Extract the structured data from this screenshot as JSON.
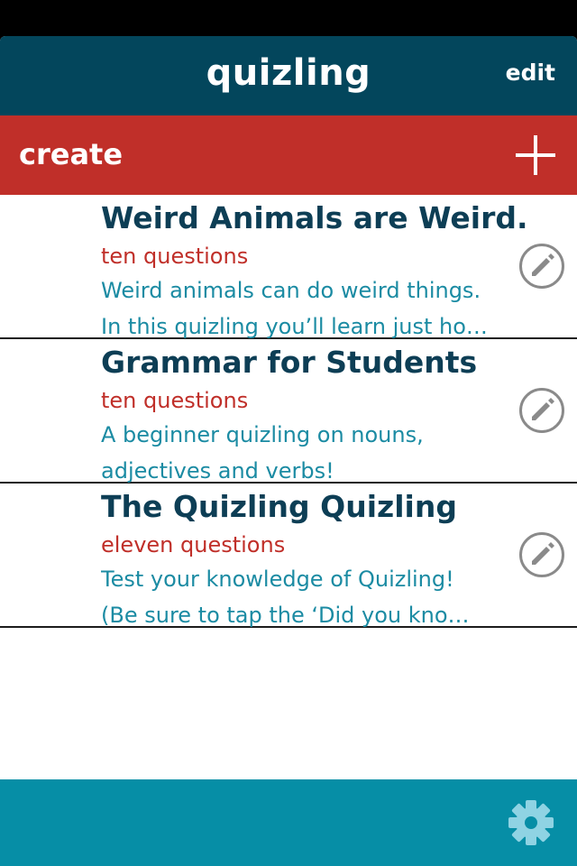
{
  "header": {
    "title": "quizling",
    "edit_label": "edit"
  },
  "create_bar": {
    "label": "create",
    "icon": "plus-icon"
  },
  "quizzes": [
    {
      "title": "Weird Animals are Weird.",
      "count": "ten questions",
      "desc_line1": "Weird animals can do weird things.",
      "desc_line2": "In this quizling you’ll learn just ho…"
    },
    {
      "title": "Grammar for Students",
      "count": "ten questions",
      "desc_line1": "A beginner quizling on nouns,",
      "desc_line2": "adjectives and verbs!"
    },
    {
      "title": "The Quizling Quizling",
      "count": "eleven questions",
      "desc_line1": "Test your knowledge of Quizling!",
      "desc_line2": "(Be sure to tap the ‘Did you kno…"
    }
  ],
  "footer": {
    "icon": "gear-icon"
  },
  "colors": {
    "navbar": "#03465c",
    "create_bar": "#c02f29",
    "title_text": "#0d3e55",
    "count_text": "#c02f29",
    "desc_text": "#1b8ba3",
    "footer": "#068ea6"
  }
}
